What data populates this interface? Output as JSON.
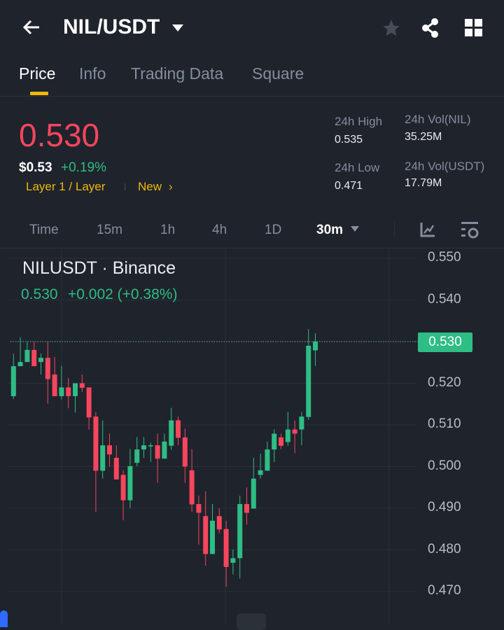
{
  "header": {
    "back_icon": "arrow-left-icon",
    "pair": "NIL/USDT",
    "icons": [
      "star-icon",
      "share-icon",
      "grid-icon"
    ]
  },
  "tabs": [
    "Price",
    "Info",
    "Trading Data",
    "Square"
  ],
  "ticker": {
    "last_price": "0.530",
    "usd_price": "$0.53",
    "change": "+0.19%",
    "tag1": "Layer 1 / Layer",
    "tag2": "New",
    "high_label": "24h High",
    "high": "0.535",
    "low_label": "24h Low",
    "low": "0.471",
    "vol_base_label": "24h Vol(NIL)",
    "vol_base": "35.25M",
    "vol_quote_label": "24h Vol(USDT)",
    "vol_quote": "17.79M"
  },
  "timeframes": [
    "Time",
    "15m",
    "1h",
    "4h",
    "1D",
    "30m"
  ],
  "chart": {
    "symbol": "NILUSDT · Binance",
    "last": "0.530",
    "change": "+0.002 (+0.38%)",
    "price_badge": "0.530",
    "y_labels": [
      "0.550",
      "0.540",
      "0.530",
      "0.520",
      "0.510",
      "0.500",
      "0.490",
      "0.480",
      "0.470"
    ],
    "up_color": "#2ebd85",
    "down_color": "#f6465d"
  },
  "chart_data": {
    "type": "candlestick",
    "interval": "30m",
    "ylim": [
      0.47,
      0.55
    ],
    "current": 0.53,
    "ohlc": [
      [
        0.5169,
        0.5271,
        0.5162,
        0.5241
      ],
      [
        0.5241,
        0.5311,
        0.5241,
        0.5251
      ],
      [
        0.5251,
        0.5299,
        0.5251,
        0.528
      ],
      [
        0.528,
        0.5299,
        0.5241,
        0.5241
      ],
      [
        0.5251,
        0.5271,
        0.5221,
        0.5261
      ],
      [
        0.5261,
        0.5299,
        0.5151,
        0.521
      ],
      [
        0.5221,
        0.5263,
        0.5169,
        0.5169
      ],
      [
        0.5169,
        0.5242,
        0.5161,
        0.519
      ],
      [
        0.519,
        0.5213,
        0.514,
        0.5169
      ],
      [
        0.5169,
        0.52,
        0.513,
        0.52
      ],
      [
        0.52,
        0.5221,
        0.5179,
        0.5189
      ],
      [
        0.519,
        0.519,
        0.5089,
        0.5118
      ],
      [
        0.512,
        0.5131,
        0.4891,
        0.499
      ],
      [
        0.499,
        0.5111,
        0.4971,
        0.5051
      ],
      [
        0.5051,
        0.5079,
        0.5,
        0.5029
      ],
      [
        0.5021,
        0.5051,
        0.4969,
        0.4969
      ],
      [
        0.498,
        0.4991,
        0.4871,
        0.4919
      ],
      [
        0.4919,
        0.5042,
        0.49,
        0.5001
      ],
      [
        0.5009,
        0.5071,
        0.5001,
        0.5041
      ],
      [
        0.5041,
        0.5071,
        0.5021,
        0.5051
      ],
      [
        0.505,
        0.5057,
        0.5011,
        0.5051
      ],
      [
        0.5051,
        0.5079,
        0.4961,
        0.5019
      ],
      [
        0.5019,
        0.5079,
        0.5019,
        0.506
      ],
      [
        0.505,
        0.5141,
        0.504,
        0.5111
      ],
      [
        0.5111,
        0.512,
        0.5051,
        0.5069
      ],
      [
        0.507,
        0.5091,
        0.4961,
        0.5
      ],
      [
        0.4991,
        0.5042,
        0.4891,
        0.4909
      ],
      [
        0.491,
        0.493,
        0.4812,
        0.4889
      ],
      [
        0.4881,
        0.4941,
        0.4762,
        0.479
      ],
      [
        0.479,
        0.491,
        0.479,
        0.487
      ],
      [
        0.4881,
        0.49,
        0.484,
        0.4849
      ],
      [
        0.485,
        0.487,
        0.4711,
        0.4759
      ],
      [
        0.4769,
        0.4801,
        0.4741,
        0.478
      ],
      [
        0.478,
        0.493,
        0.4731,
        0.491
      ],
      [
        0.491,
        0.495,
        0.486,
        0.4889
      ],
      [
        0.4899,
        0.5021,
        0.4899,
        0.4971
      ],
      [
        0.498,
        0.5031,
        0.4971,
        0.4991
      ],
      [
        0.499,
        0.506,
        0.499,
        0.5041
      ],
      [
        0.5041,
        0.5089,
        0.5011,
        0.5079
      ],
      [
        0.507,
        0.5079,
        0.5042,
        0.505
      ],
      [
        0.5059,
        0.5131,
        0.505,
        0.5089
      ],
      [
        0.5089,
        0.5111,
        0.5032,
        0.5079
      ],
      [
        0.5089,
        0.5131,
        0.5051,
        0.512
      ],
      [
        0.5119,
        0.533,
        0.5112,
        0.529
      ],
      [
        0.5279,
        0.532,
        0.5242,
        0.53
      ]
    ]
  }
}
